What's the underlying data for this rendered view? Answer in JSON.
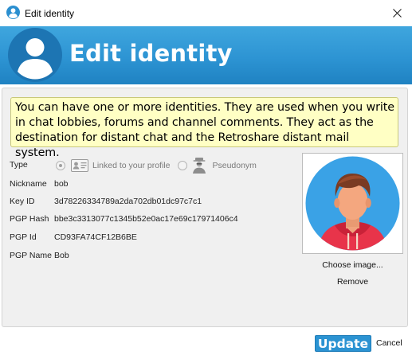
{
  "window": {
    "title": "Edit identity",
    "icon": "person-circle-icon",
    "close_icon": "close-icon"
  },
  "banner": {
    "title": "Edit identity",
    "icon": "person-circle-icon"
  },
  "note": {
    "text": "You can have one or more identities. They are used when you write in chat lobbies, forums and channel comments. They act as the destination for distant chat and the Retroshare distant mail system."
  },
  "form": {
    "type_label": "Type",
    "type_options": [
      {
        "label": "Linked to your profile",
        "icon": "profile-card-icon",
        "selected": true
      },
      {
        "label": "Pseudonym",
        "icon": "anonymous-person-icon",
        "selected": false
      }
    ],
    "nickname_label": "Nickname",
    "nickname_value": "bob",
    "key_id_label": "Key ID",
    "key_id_value": "3d78226334789a2da702db01dc97c7c1",
    "pgp_hash_label": "PGP Hash",
    "pgp_hash_value": "bbe3c3313077c1345b52e0ac17e69c17971406c4",
    "pgp_id_label": "PGP Id",
    "pgp_id_value": "CD93FA74CF12B6BE",
    "pgp_name_label": "PGP Name",
    "pgp_name_value": "Bob"
  },
  "avatar": {
    "choose_label": "Choose image...",
    "remove_label": "Remove"
  },
  "buttons": {
    "update_label": "Update",
    "cancel_label": "Cancel"
  },
  "colors": {
    "banner_blue": "#2d94d3",
    "note_yellow": "#ffffc4",
    "update_blue": "#2b93d2",
    "avatar_bg": "#3aa2e6",
    "avatar_jacket": "#e8344a"
  }
}
